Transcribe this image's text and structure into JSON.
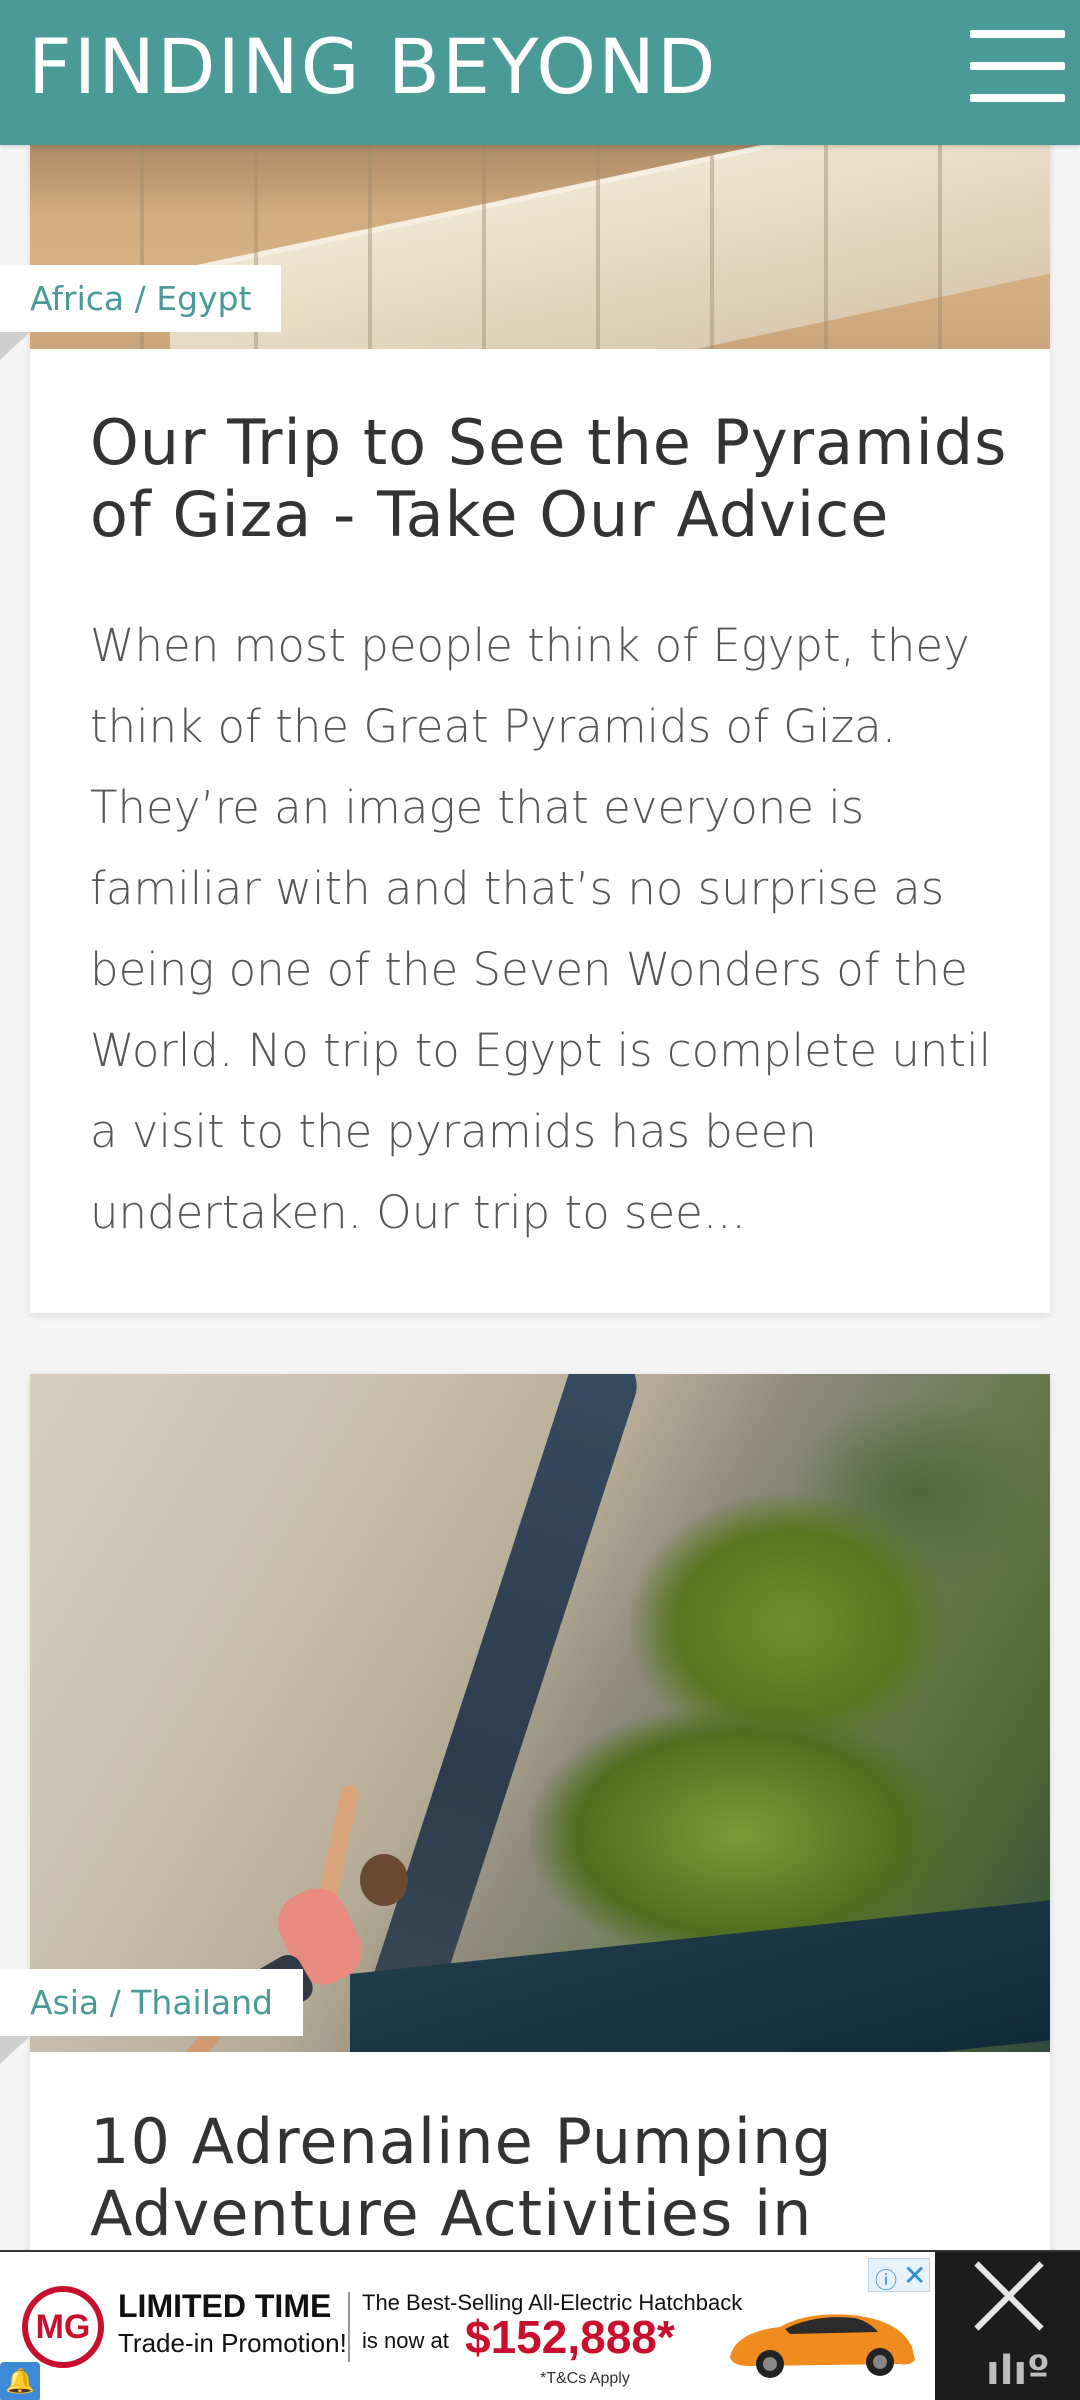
{
  "header": {
    "site_title": "FINDING BEYOND"
  },
  "posts": [
    {
      "category": "Africa / Egypt",
      "title": "Our Trip to See the Pyramids of Giza - Take Our Advice",
      "excerpt": "When most people think of Egypt, they think of the Great Pyramids of Giza. They’re an image that everyone is familiar with and that’s no surprise as being one of the Seven Wonders of the World. No trip to Egypt is complete until a visit to the pyramids has been undertaken. Our trip to see..."
    },
    {
      "category": "Asia / Thailand",
      "title": "10 Adrenaline Pumping Adventure Activities in",
      "excerpt": ""
    }
  ],
  "ad": {
    "brand": "MG",
    "headline": "LIMITED TIME",
    "subline": "Trade-in Promotion!",
    "best_selling": "The Best-Selling All-Electric Hatchback",
    "now_at": "is now at",
    "price": "$152,888*",
    "terms": "*T&Cs Apply"
  },
  "colors": {
    "header": "#4a9a97",
    "accent": "#4a9a97",
    "ad_red": "#c8102e"
  }
}
